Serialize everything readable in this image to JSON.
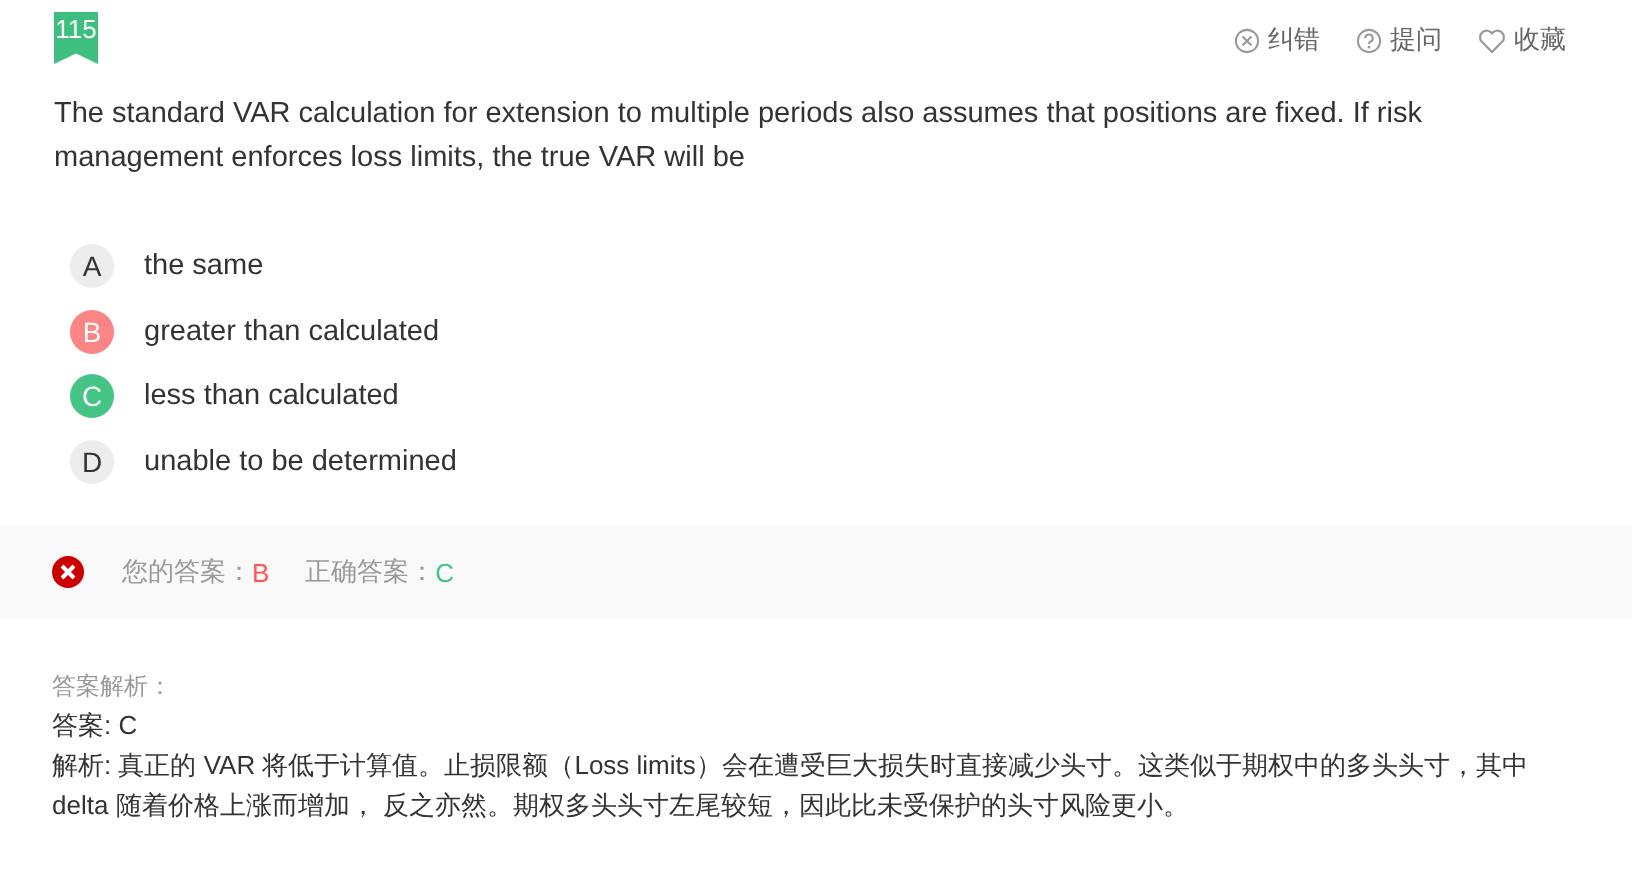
{
  "question": {
    "number": "115",
    "text": "The standard VAR calculation for extension to multiple periods also assumes that positions are fixed. If risk management enforces loss limits, the true VAR will be"
  },
  "actions": [
    {
      "kind": "report",
      "label": "纠错"
    },
    {
      "kind": "ask",
      "label": "提问"
    },
    {
      "kind": "favorite",
      "label": "收藏"
    }
  ],
  "options": [
    {
      "letter": "A",
      "text": "the same",
      "selected": false,
      "correct": false
    },
    {
      "letter": "B",
      "text": "greater than calculated",
      "selected": true,
      "correct": false
    },
    {
      "letter": "C",
      "text": "less than calculated",
      "selected": false,
      "correct": true
    },
    {
      "letter": "D",
      "text": "unable to be determined",
      "selected": false,
      "correct": false
    }
  ],
  "result": {
    "is_correct": false,
    "your_label": "您的答案：",
    "your_answer": "B",
    "correct_label": "正确答案：",
    "correct_answer": "C"
  },
  "explanation": {
    "heading": "答案解析：",
    "answer": "答案: C",
    "body": "解析: 真正的 VAR 将低于计算值。止损限额（Loss limits）会在遭受巨大损失时直接减少头寸。这类似于期权中的多头头寸，其中 delta 随着价格上涨而增加， 反之亦然。期权多头头寸左尾较短，因此比未受保护的头寸风险更小。"
  }
}
